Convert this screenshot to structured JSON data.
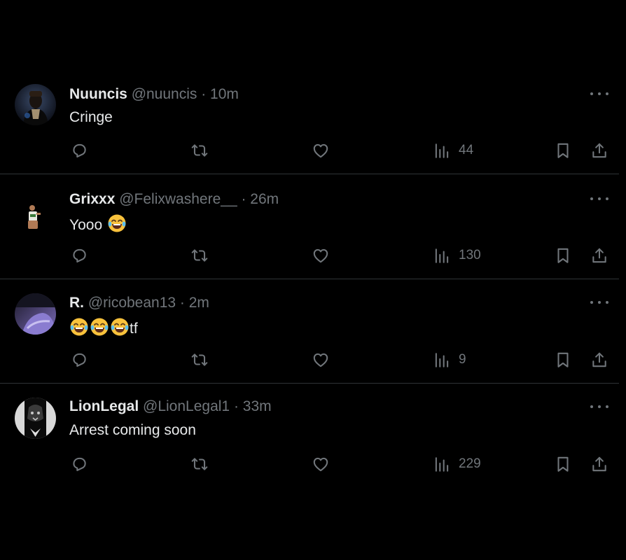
{
  "tweets": [
    {
      "display_name": "Nuuncis",
      "handle": "@nuuncis",
      "time": "· 10m",
      "text": "Cringe",
      "views": "44",
      "avatar_color": "#2b3a55"
    },
    {
      "display_name": "Grixxx",
      "handle": "@Felixwashere__",
      "time": "· 26m",
      "text": "Yooo",
      "emoji": "😂",
      "views": "130",
      "avatar_color": "#000000"
    },
    {
      "display_name": "R.",
      "handle": "@ricobean13",
      "time": "· 2m",
      "text_prefix": "😂😂😂",
      "text": "tf",
      "views": "9",
      "avatar_color": "#6a5fa8"
    },
    {
      "display_name": "LionLegal",
      "handle": "@LionLegal1",
      "time": "· 33m",
      "text": "Arrest coming soon",
      "views": "229",
      "avatar_color": "#d9d9d9"
    }
  ],
  "icons": {
    "reply": "reply-icon",
    "retweet": "retweet-icon",
    "like": "like-icon",
    "views": "views-icon",
    "bookmark": "bookmark-icon",
    "share": "share-icon",
    "more": "more-icon"
  },
  "colors": {
    "background": "#000000",
    "text": "#e7e9ea",
    "secondary": "#71767b",
    "divider": "#2f3336"
  }
}
